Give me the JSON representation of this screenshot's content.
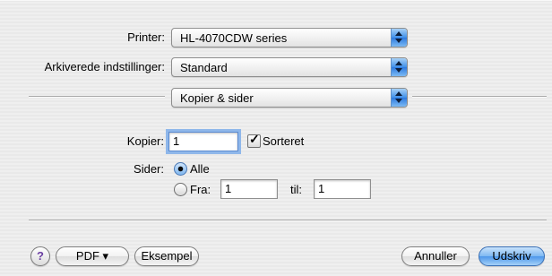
{
  "printer": {
    "label": "Printer:",
    "value": "HL-4070CDW series"
  },
  "presets": {
    "label": "Arkiverede indstillinger:",
    "value": "Standard"
  },
  "section": {
    "value": "Kopier & sider"
  },
  "copies": {
    "label": "Kopier:",
    "value": "1",
    "collate_label": "Sorteret",
    "collate_checked": true
  },
  "pages": {
    "label": "Sider:",
    "all_label": "Alle",
    "from_label": "Fra:",
    "from_value": "1",
    "to_label": "til:",
    "to_value": "1",
    "selected": "all"
  },
  "buttons": {
    "help": "?",
    "pdf": "PDF ▾",
    "preview": "Eksempel",
    "cancel": "Annuller",
    "print": "Udskriv"
  },
  "colors": {
    "accent": "#4d97ea",
    "help_glyph": "#6a3ea2"
  }
}
